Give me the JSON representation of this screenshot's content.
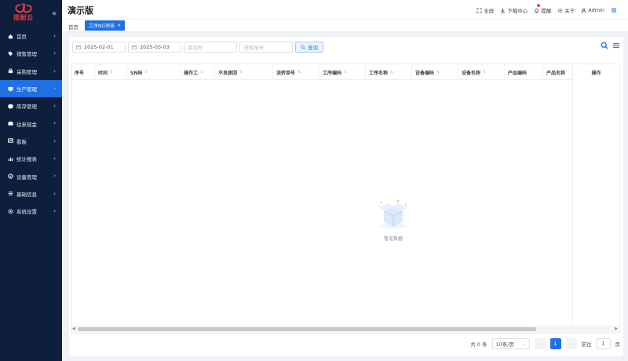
{
  "brand": {
    "logo_text": "南耐云",
    "accent": "#1f6fe5",
    "logo_color": "#e33b3b"
  },
  "header": {
    "title": "演示版",
    "actions": [
      {
        "label": "全屏",
        "icon": "fullscreen-icon"
      },
      {
        "label": "下载中心",
        "icon": "download-icon"
      },
      {
        "label": "提醒",
        "icon": "bell-icon"
      },
      {
        "label": "关于",
        "icon": "gear-icon"
      },
      {
        "label": "Admin",
        "icon": "user-icon"
      }
    ]
  },
  "sidebar": {
    "items": [
      {
        "label": "首页",
        "icon": "home-icon"
      },
      {
        "label": "销售管理",
        "icon": "tag-icon"
      },
      {
        "label": "采购管理",
        "icon": "cart-icon"
      },
      {
        "label": "生产管理",
        "icon": "monitor-icon",
        "active": true
      },
      {
        "label": "库存管理",
        "icon": "box-icon"
      },
      {
        "label": "往来现金",
        "icon": "cash-icon"
      },
      {
        "label": "看板",
        "icon": "dashboard-icon"
      },
      {
        "label": "统计报表",
        "icon": "chart-icon"
      },
      {
        "label": "设备管理",
        "icon": "device-icon"
      },
      {
        "label": "基础信息",
        "icon": "settings-sliders-icon"
      },
      {
        "label": "系统设置",
        "icon": "gear-icon"
      }
    ]
  },
  "tabs": {
    "home": "首页",
    "active": "工序NG审核"
  },
  "filters": {
    "start_date": "2025-02-01",
    "end_date": "2025-03-03",
    "serial_placeholder": "序列号",
    "flow_placeholder": "流转单号",
    "search_label": "查询"
  },
  "table": {
    "columns": [
      "序号",
      "时间",
      "SN码",
      "操作工",
      "不良原因",
      "流转单号",
      "工序编码",
      "工序名称",
      "设备编码",
      "设备名称",
      "产品编码",
      "产品名称"
    ],
    "action_column": "操作",
    "empty_text": "暂无数据"
  },
  "pagination": {
    "total": "共 0 条",
    "page_size": "10条/页",
    "current_page": "1",
    "goto_label": "前往",
    "goto_value": "1",
    "page_unit": "页"
  }
}
